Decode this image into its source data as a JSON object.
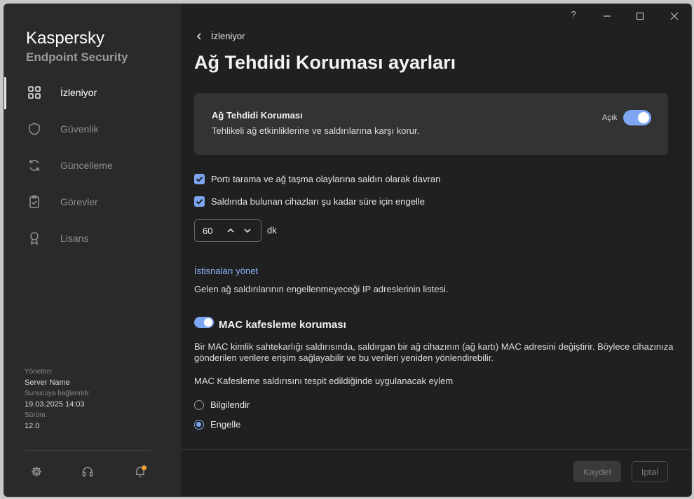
{
  "window": {
    "help_label": "?",
    "brand_line1": "Kaspersky",
    "brand_line2": "Endpoint Security"
  },
  "sidebar": {
    "items": [
      {
        "label": "İzleniyor",
        "icon": "dashboard-icon",
        "active": true
      },
      {
        "label": "Güvenlik",
        "icon": "shield-icon"
      },
      {
        "label": "Güncelleme",
        "icon": "refresh-icon"
      },
      {
        "label": "Görevler",
        "icon": "clipboard-icon"
      },
      {
        "label": "Lisans",
        "icon": "award-icon"
      }
    ],
    "meta": {
      "managed_by_label": "Yöneten:",
      "managed_by_value": "Server Name",
      "connected_label": "Sunucuya bağlanıldı:",
      "connected_value": "19.03.2025 14:03",
      "version_label": "Sürüm:",
      "version_value": "12.0"
    }
  },
  "header": {
    "back_label": "İzleniyor",
    "title": "Ağ Tehdidi Koruması ayarları"
  },
  "card": {
    "title": "Ağ Tehdidi Koruması",
    "description": "Tehlikeli ağ etkinliklerine ve saldırılarına karşı korur.",
    "state_label": "Açık"
  },
  "options": {
    "port_scan_label": "Portı tarama ve ağ taşma olaylarına saldırı olarak davran",
    "block_label": "Saldırıda bulunan cihazları şu kadar süre için engelle",
    "duration_value": "60",
    "duration_unit": "dk"
  },
  "exclusions": {
    "link_label": "İstisnaları yönet",
    "description": "Gelen ağ saldırılarının engellenmeyeceği IP adreslerinin listesi."
  },
  "mac": {
    "title": "MAC kafesleme koruması",
    "description": "Bir MAC kimlik sahtekarlığı saldırısında, saldırgan bir ağ cihazının (ağ kartı) MAC adresini değiştirir. Böylece cihazınıza gönderilen verilere erişim sağlayabilir ve bu verileri yeniden yönlendirebilir.",
    "action_label": "MAC Kafesleme saldırısını tespit edildiğinde uygulanacak eylem",
    "options": [
      "Bilgilendir",
      "Engelle"
    ],
    "selected": "Engelle"
  },
  "footer": {
    "save_label": "Kaydet",
    "cancel_label": "İptal"
  },
  "colors": {
    "accent": "#7ea6f2",
    "link": "#8bb0f5",
    "notification": "#f0a030"
  }
}
